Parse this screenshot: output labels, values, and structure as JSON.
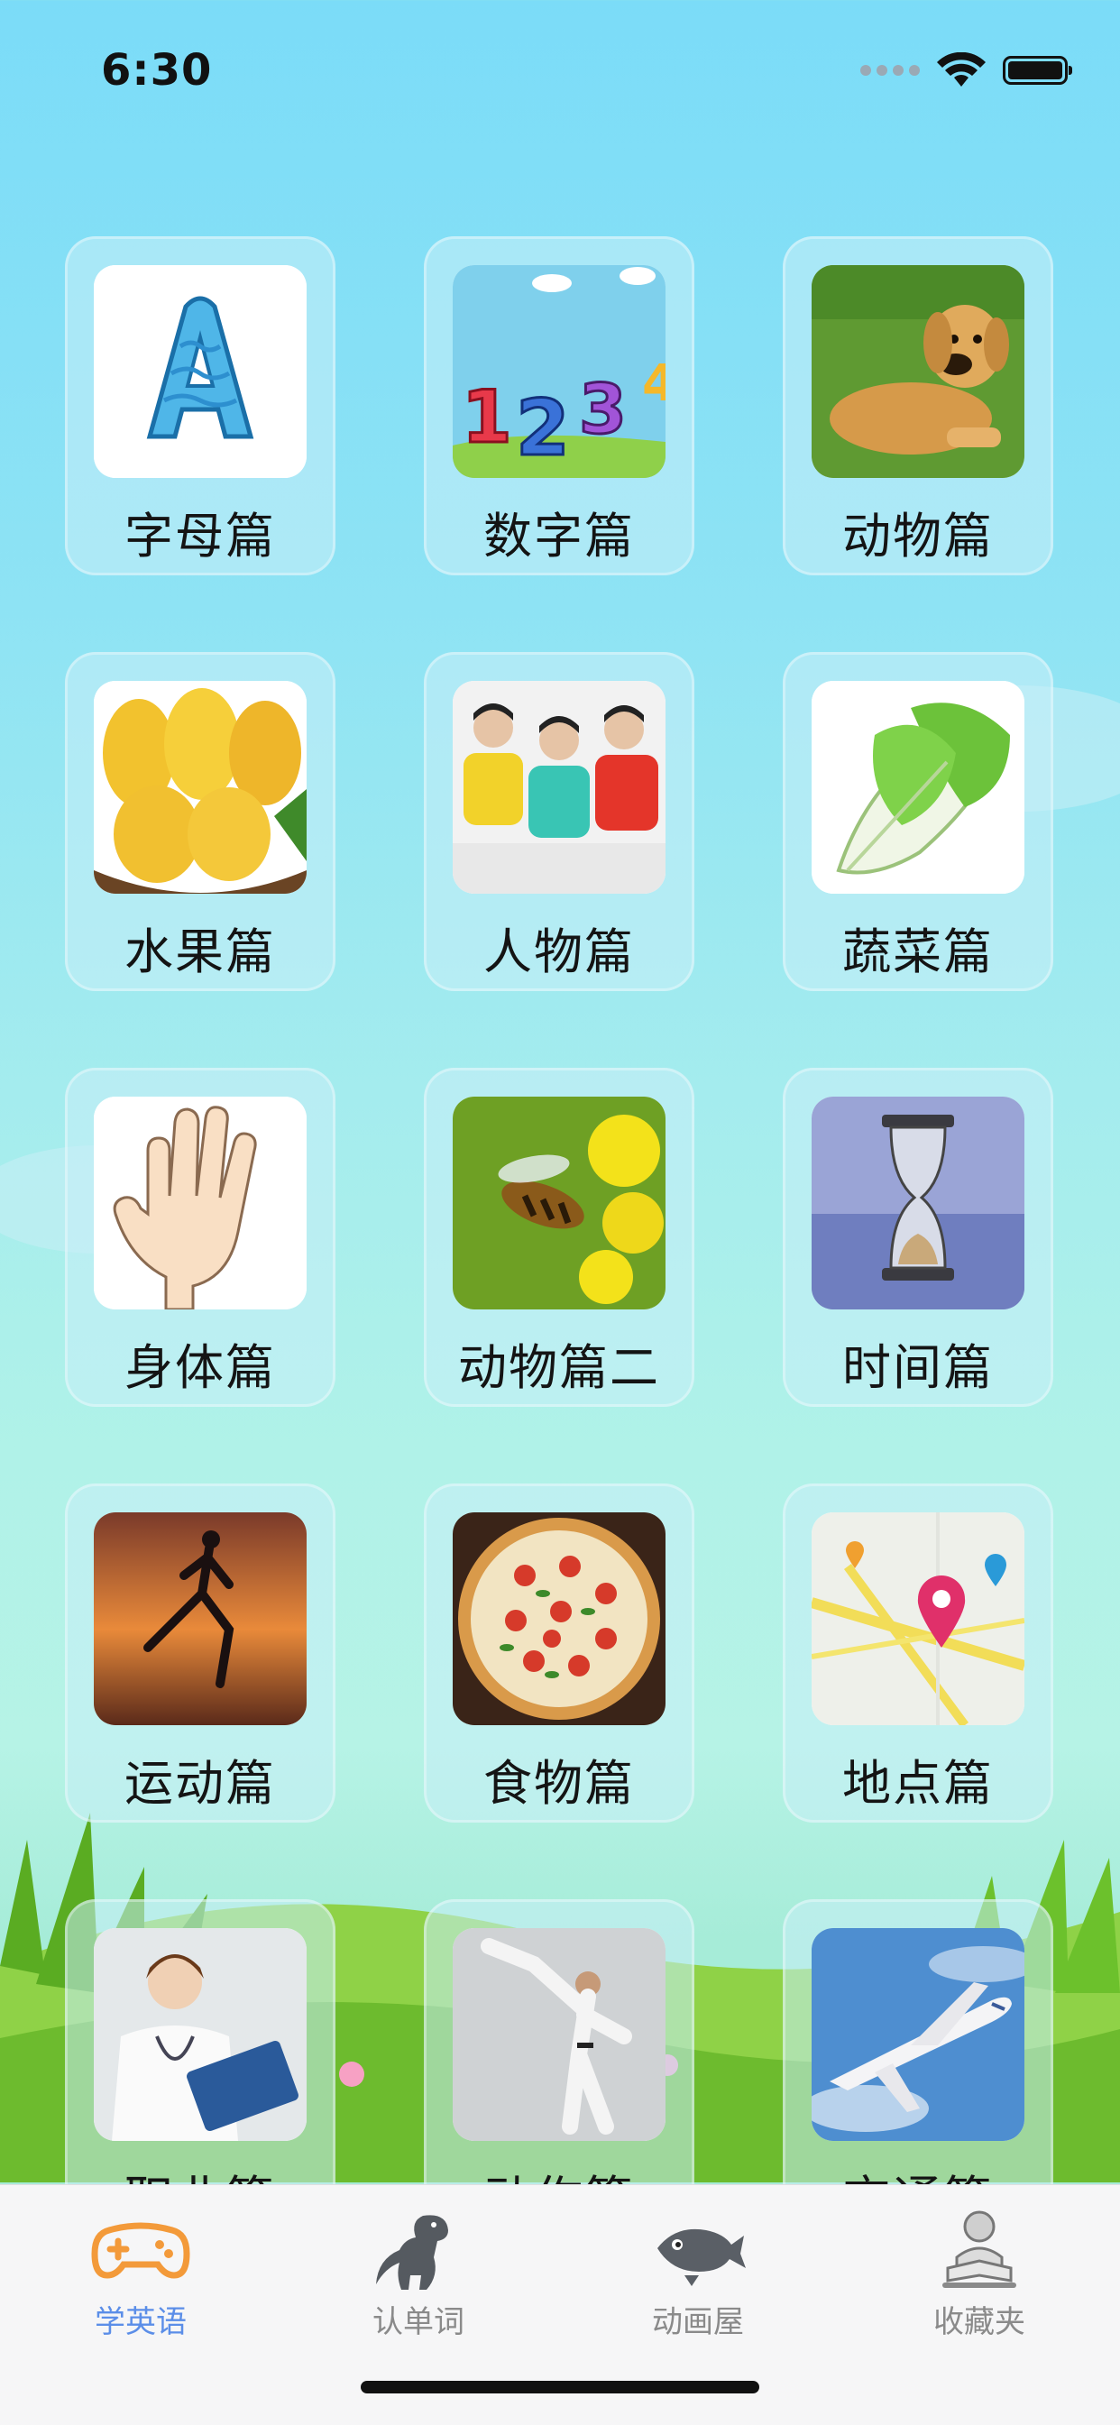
{
  "status_bar": {
    "time": "6:30"
  },
  "categories": [
    {
      "label": "字母篇",
      "icon": "letter-a-icon"
    },
    {
      "label": "数字篇",
      "icon": "numbers-icon"
    },
    {
      "label": "动物篇",
      "icon": "dog-icon"
    },
    {
      "label": "水果篇",
      "icon": "mango-icon"
    },
    {
      "label": "人物篇",
      "icon": "people-icon"
    },
    {
      "label": "蔬菜篇",
      "icon": "cabbage-icon"
    },
    {
      "label": "身体篇",
      "icon": "hand-icon"
    },
    {
      "label": "动物篇二",
      "icon": "bee-icon"
    },
    {
      "label": "时间篇",
      "icon": "hourglass-icon"
    },
    {
      "label": "运动篇",
      "icon": "runner-icon"
    },
    {
      "label": "食物篇",
      "icon": "pizza-icon"
    },
    {
      "label": "地点篇",
      "icon": "map-pin-icon"
    },
    {
      "label": "职业篇",
      "icon": "doctor-icon"
    },
    {
      "label": "动作篇",
      "icon": "karate-icon"
    },
    {
      "label": "交通篇",
      "icon": "airplane-icon"
    }
  ],
  "tabbar": {
    "tabs": [
      {
        "label": "学英语",
        "icon": "gamepad-icon",
        "active": true
      },
      {
        "label": "认单词",
        "icon": "dinosaur-icon",
        "active": false
      },
      {
        "label": "动画屋",
        "icon": "fish-icon",
        "active": false
      },
      {
        "label": "收藏夹",
        "icon": "reading-baby-icon",
        "active": false
      }
    ]
  },
  "colors": {
    "active_tab": "#5b8ee8",
    "inactive_tab": "#8a8a8a",
    "card_background": "rgba(200,238,248,0.55)"
  }
}
